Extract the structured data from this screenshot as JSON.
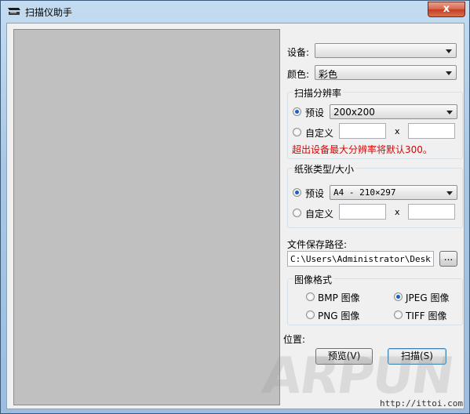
{
  "window": {
    "title": "扫描仪助手",
    "close_glyph": "x"
  },
  "device": {
    "label": "设备:",
    "value": ""
  },
  "color": {
    "label": "颜色:",
    "value": "彩色"
  },
  "resolution": {
    "group_title": "扫描分辨率",
    "preset_label": "预设",
    "preset_value": "200x200",
    "custom_label": "自定义",
    "x_sep": "x",
    "width_value": "",
    "height_value": "",
    "warning": "超出设备最大分辨率将默认300。"
  },
  "paper": {
    "group_title": "纸张类型/大小",
    "preset_label": "预设",
    "preset_value": "A4 - 210×297",
    "custom_label": "自定义",
    "x_sep": "x",
    "width_value": "",
    "height_value": ""
  },
  "save_path": {
    "label": "文件保存路径:",
    "value": "C:\\Users\\Administrator\\Desktop",
    "browse_label": "..."
  },
  "format": {
    "group_title": "图像格式",
    "options": [
      {
        "label": "BMP 图像",
        "selected": false
      },
      {
        "label": "JPEG 图像",
        "selected": true
      },
      {
        "label": "PNG 图像",
        "selected": false
      },
      {
        "label": "TIFF 图像",
        "selected": false
      }
    ]
  },
  "position_label": "位置:",
  "buttons": {
    "preview": "预览(V)",
    "scan": "扫描(S)"
  },
  "watermark": {
    "brand": "ARPUN",
    "site": "http://ittoi.com"
  }
}
